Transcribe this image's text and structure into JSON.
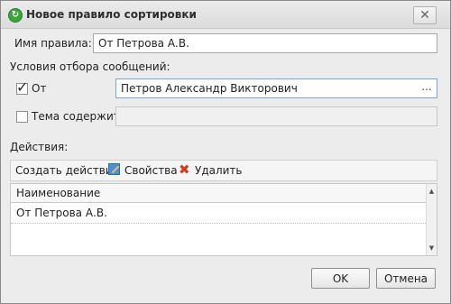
{
  "window": {
    "title": "Новое правило сортировки",
    "app_icon": "refresh-green-icon",
    "close_glyph": "✕"
  },
  "rule_name": {
    "label": "Имя правила:",
    "value": "От Петрова А.В."
  },
  "conditions": {
    "heading": "Условия отбора сообщений:",
    "from": {
      "label": "От",
      "checked": true,
      "value": "Петров Александр Викторович",
      "browse_label": "..."
    },
    "subject": {
      "label": "Тема содержит",
      "checked": false,
      "value": ""
    }
  },
  "actions": {
    "heading": "Действия:",
    "toolbar": {
      "create_label": "Создать действие",
      "properties_label": "Свойства",
      "delete_label": "Удалить"
    },
    "table": {
      "column_header": "Наименование",
      "rows": [
        "От Петрова А.В."
      ]
    }
  },
  "footer": {
    "ok_label": "OK",
    "cancel_label": "Отмена"
  }
}
